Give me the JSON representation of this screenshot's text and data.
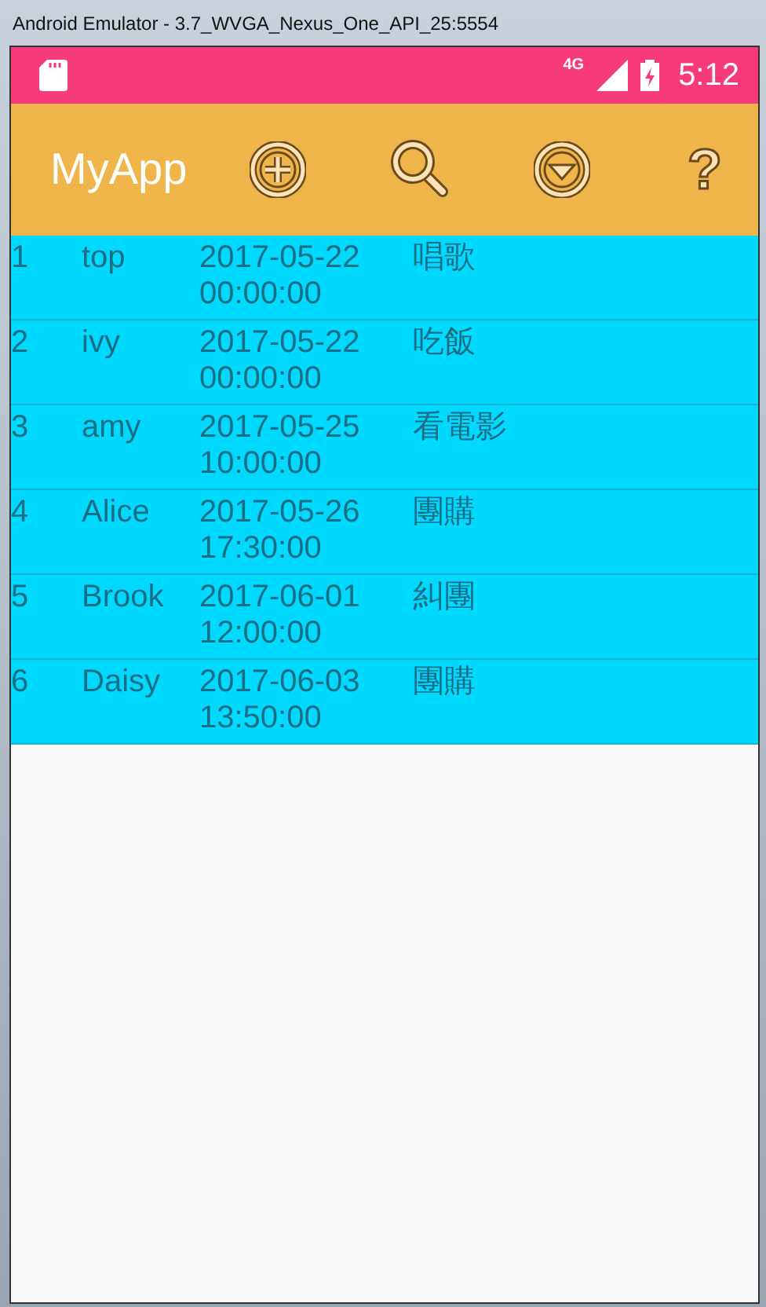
{
  "window": {
    "title": "Android Emulator - 3.7_WVGA_Nexus_One_API_25:5554"
  },
  "status_bar": {
    "network": "4G",
    "time": "5:12"
  },
  "app_bar": {
    "title": "MyApp",
    "actions": [
      {
        "kind": "add"
      },
      {
        "kind": "search"
      },
      {
        "kind": "dropdown"
      },
      {
        "kind": "help",
        "label": "?"
      }
    ]
  },
  "rows": [
    {
      "id": "1",
      "name": "top",
      "datetime": "2017-05-22 00:00:00",
      "event": "唱歌"
    },
    {
      "id": "2",
      "name": "ivy",
      "datetime": "2017-05-22 00:00:00",
      "event": "吃飯"
    },
    {
      "id": "3",
      "name": "amy",
      "datetime": "2017-05-25 10:00:00",
      "event": "看電影"
    },
    {
      "id": "4",
      "name": "Alice",
      "datetime": "2017-05-26 17:30:00",
      "event": "團購"
    },
    {
      "id": "5",
      "name": "Brook",
      "datetime": "2017-06-01 12:00:00",
      "event": "糾團"
    },
    {
      "id": "6",
      "name": "Daisy",
      "datetime": "2017-06-03 13:50:00",
      "event": "團購"
    }
  ]
}
